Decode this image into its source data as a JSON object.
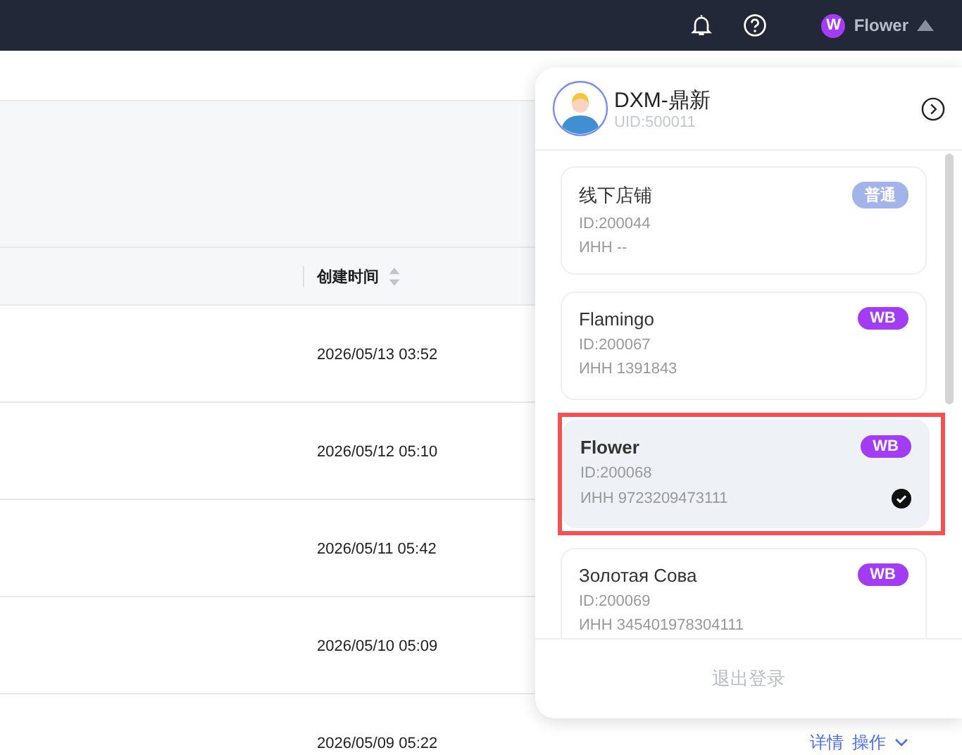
{
  "top_bar": {
    "user_initial": "W",
    "user_name": "Flower",
    "menu_open": true
  },
  "table": {
    "columns": [
      {
        "label": "创建时间",
        "sortable": true
      }
    ],
    "rows": [
      {
        "created": "2026/05/13 03:52",
        "actions": []
      },
      {
        "created": "2026/05/12 05:10",
        "actions": []
      },
      {
        "created": "2026/05/11 05:42",
        "actions": []
      },
      {
        "created": "2026/05/10 05:09",
        "actions": []
      },
      {
        "created": "2026/05/09 05:22",
        "actions": [
          "详情",
          "操作"
        ]
      }
    ]
  },
  "account_menu": {
    "account_name": "DXM-鼎新",
    "uid": "UID:500011",
    "stores": [
      {
        "name": "线下店铺",
        "id": "ID:200044",
        "inn": "ИНН --",
        "tag": "普通",
        "color": "#a3b4ea",
        "selected": false
      },
      {
        "name": "Flamingo",
        "id": "ID:200067",
        "inn": "ИНН 1391843",
        "tag": "WB",
        "color": "#a23cf5",
        "selected": false
      },
      {
        "name": "Flower",
        "id": "ID:200068",
        "inn": "ИНН 9723209473111",
        "tag": "WB",
        "color": "#a23cf5",
        "selected": true
      },
      {
        "name": "Золотая Сова",
        "id": "ID:200069",
        "inn": "ИНН 345401978304111",
        "tag": "WB",
        "color": "#a23cf5",
        "selected": false
      }
    ],
    "logout": "退出登录"
  }
}
